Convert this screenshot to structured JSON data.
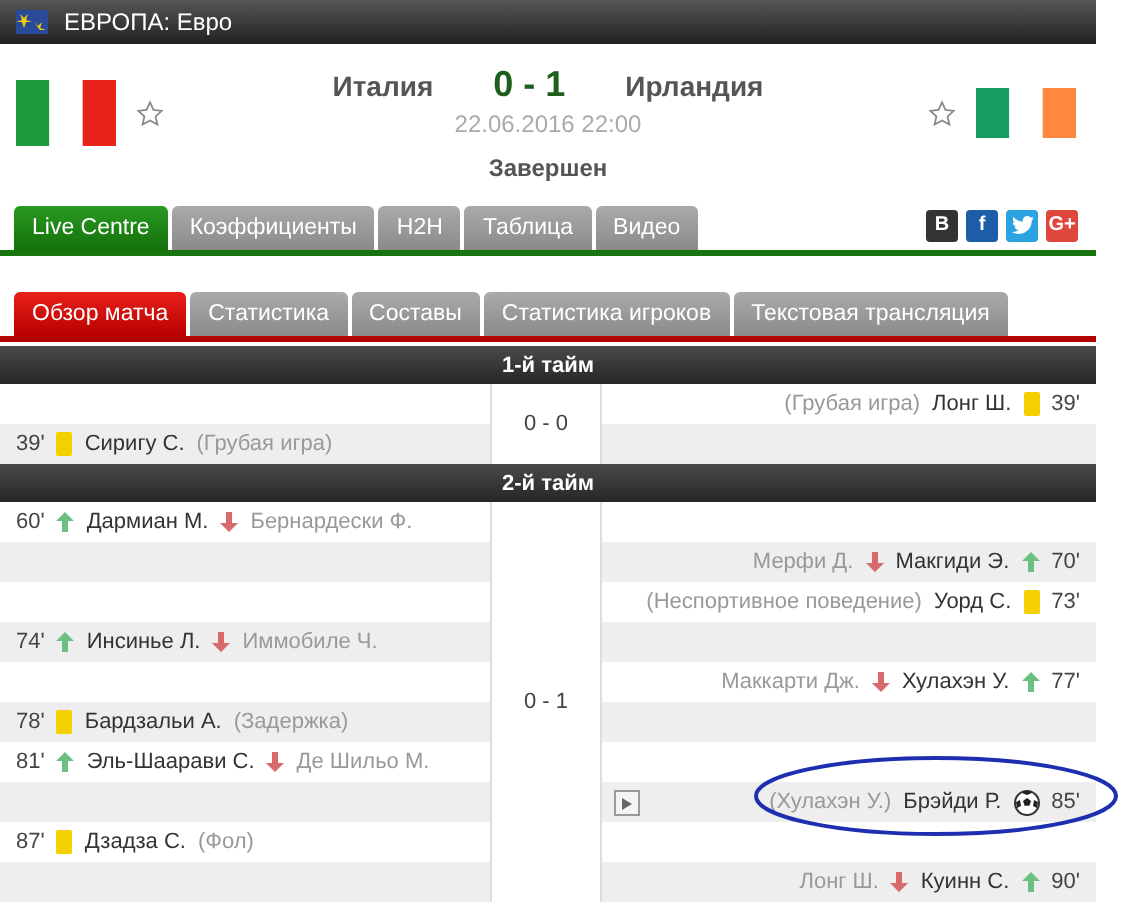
{
  "top_bar": {
    "title": "ЕВРОПА: Евро"
  },
  "match": {
    "home": "Италия",
    "score": "0 - 1",
    "away": "Ирландия",
    "date": "22.06.2016 22:00",
    "status": "Завершен"
  },
  "tabs": [
    {
      "label": "Live Centre",
      "selected": true
    },
    {
      "label": "Коэффициенты",
      "selected": false
    },
    {
      "label": "H2H",
      "selected": false
    },
    {
      "label": "Таблица",
      "selected": false
    },
    {
      "label": "Видео",
      "selected": false
    }
  ],
  "social": [
    {
      "kind": "vk",
      "label": "В"
    },
    {
      "kind": "facebook",
      "label": "f"
    },
    {
      "kind": "twitter"
    },
    {
      "kind": "google",
      "label": "G+"
    }
  ],
  "subtabs": [
    {
      "label": "Обзор матча",
      "selected": true
    },
    {
      "label": "Статистика",
      "selected": false
    },
    {
      "label": "Составы",
      "selected": false
    },
    {
      "label": "Статистика игроков",
      "selected": false
    },
    {
      "label": "Текстовая трансляция",
      "selected": false
    }
  ],
  "halves": [
    {
      "title": "1-й тайм",
      "score": "0 - 0",
      "events": [
        {
          "away": {
            "minute": "39'",
            "kind": "yellow_card",
            "player": "Лонг Ш.",
            "note": "(Грубая игра)"
          }
        },
        {
          "home": {
            "minute": "39'",
            "kind": "yellow_card",
            "player": "Сиригу С.",
            "note": "(Грубая игра)"
          }
        }
      ]
    },
    {
      "title": "2-й тайм",
      "score": "0 - 1",
      "events": [
        {
          "home": {
            "minute": "60'",
            "kind": "substitution",
            "player": "Дармиан М.",
            "player_out": "Бернардески Ф."
          }
        },
        {
          "away": {
            "minute": "70'",
            "kind": "substitution",
            "player": "Макгиди Э.",
            "player_out": "Мерфи Д."
          }
        },
        {
          "away": {
            "minute": "73'",
            "kind": "yellow_card",
            "player": "Уорд С.",
            "note": "(Неспортивное поведение)"
          }
        },
        {
          "home": {
            "minute": "74'",
            "kind": "substitution",
            "player": "Инсинье Л.",
            "player_out": "Иммобиле Ч."
          }
        },
        {
          "away": {
            "minute": "77'",
            "kind": "substitution",
            "player": "Хулахэн У.",
            "player_out": "Маккарти Дж."
          }
        },
        {
          "home": {
            "minute": "78'",
            "kind": "yellow_card",
            "player": "Бардзальи А.",
            "note": "(Задержка)"
          }
        },
        {
          "home": {
            "minute": "81'",
            "kind": "substitution",
            "player": "Эль-Шаарави С.",
            "player_out": "Де Шильо М."
          }
        },
        {
          "away": {
            "minute": "85'",
            "kind": "goal",
            "player": "Брэйди Р.",
            "note": "(Хулахэн У.)",
            "video": true,
            "highlighted": true
          }
        },
        {
          "home": {
            "minute": "87'",
            "kind": "yellow_card",
            "player": "Дзадза С.",
            "note": "(Фол)"
          }
        },
        {
          "away": {
            "minute": "90'",
            "kind": "substitution",
            "player": "Куинн С.",
            "player_out": "Лонг Ш."
          }
        }
      ]
    }
  ]
}
